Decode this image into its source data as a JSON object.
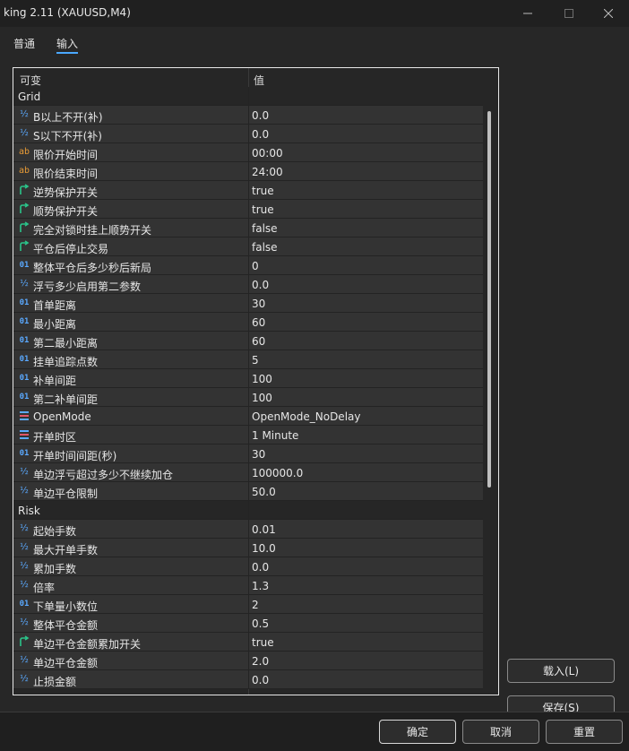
{
  "window": {
    "title": "king 2.11 (XAUUSD,M4)"
  },
  "tabs": [
    {
      "label": "普通",
      "active": false
    },
    {
      "label": "输入",
      "active": true
    }
  ],
  "grid": {
    "header": {
      "name": "可变",
      "value": "值"
    },
    "rows": [
      {
        "kind": "group",
        "name": "Grid"
      },
      {
        "kind": "param",
        "icon": "half-icon",
        "name": "B以上不开(补)",
        "value": "0.0"
      },
      {
        "kind": "param",
        "icon": "half-icon",
        "name": "S以下不开(补)",
        "value": "0.0"
      },
      {
        "kind": "param",
        "icon": "ab-icon",
        "name": "限价开始时间",
        "value": "00:00"
      },
      {
        "kind": "param",
        "icon": "ab-icon",
        "name": "限价结束时间",
        "value": "24:00"
      },
      {
        "kind": "param",
        "icon": "bool-arrow-icon",
        "name": "逆势保护开关",
        "value": "true"
      },
      {
        "kind": "param",
        "icon": "bool-arrow-icon",
        "name": "顺势保护开关",
        "value": "true"
      },
      {
        "kind": "param",
        "icon": "bool-arrow-icon",
        "name": "完全对锁时挂上顺势开关",
        "value": "false"
      },
      {
        "kind": "param",
        "icon": "bool-arrow-icon",
        "name": "平仓后停止交易",
        "value": "false"
      },
      {
        "kind": "param",
        "icon": "int-icon",
        "name": "整体平仓后多少秒后新局",
        "value": "0"
      },
      {
        "kind": "param",
        "icon": "half-icon",
        "name": "浮亏多少启用第二参数",
        "value": "0.0"
      },
      {
        "kind": "param",
        "icon": "int-icon",
        "name": "首单距离",
        "value": "30"
      },
      {
        "kind": "param",
        "icon": "int-icon",
        "name": "最小距离",
        "value": "60"
      },
      {
        "kind": "param",
        "icon": "int-icon",
        "name": "第二最小距离",
        "value": "60"
      },
      {
        "kind": "param",
        "icon": "int-icon",
        "name": "挂单追踪点数",
        "value": "5"
      },
      {
        "kind": "param",
        "icon": "int-icon",
        "name": "补单间距",
        "value": "100"
      },
      {
        "kind": "param",
        "icon": "int-icon",
        "name": "第二补单间距",
        "value": "100"
      },
      {
        "kind": "param",
        "icon": "enum-icon",
        "name": "OpenMode",
        "value": "OpenMode_NoDelay"
      },
      {
        "kind": "param",
        "icon": "enum-icon",
        "name": "开单时区",
        "value": "1 Minute"
      },
      {
        "kind": "param",
        "icon": "int-icon",
        "name": "开单时间间距(秒)",
        "value": "30"
      },
      {
        "kind": "param",
        "icon": "half-icon",
        "name": "单边浮亏超过多少不继续加仓",
        "value": "100000.0"
      },
      {
        "kind": "param",
        "icon": "half-icon",
        "name": "单边平仓限制",
        "value": "50.0"
      },
      {
        "kind": "group",
        "name": "Risk"
      },
      {
        "kind": "param",
        "icon": "half-icon",
        "name": "起始手数",
        "value": "0.01"
      },
      {
        "kind": "param",
        "icon": "half-icon",
        "name": "最大开单手数",
        "value": "10.0"
      },
      {
        "kind": "param",
        "icon": "half-icon",
        "name": "累加手数",
        "value": "0.0"
      },
      {
        "kind": "param",
        "icon": "half-icon",
        "name": "倍率",
        "value": "1.3"
      },
      {
        "kind": "param",
        "icon": "int-icon",
        "name": "下单量小数位",
        "value": "2"
      },
      {
        "kind": "param",
        "icon": "half-icon",
        "name": "整体平仓金额",
        "value": "0.5"
      },
      {
        "kind": "param",
        "icon": "bool-arrow-icon",
        "name": "单边平仓金额累加开关",
        "value": "true"
      },
      {
        "kind": "param",
        "icon": "half-icon",
        "name": "单边平仓金额",
        "value": "2.0"
      },
      {
        "kind": "param",
        "icon": "half-icon",
        "name": "止损金额",
        "value": "0.0"
      }
    ]
  },
  "side_buttons": {
    "load": "载入(L)",
    "save": "保存(S)"
  },
  "footer_buttons": {
    "ok": "确定",
    "cancel": "取消",
    "reset": "重置"
  },
  "colors": {
    "accent": "#4aa8ff",
    "bool_icon": "#2bc48a",
    "string_icon": "#e69a36",
    "number_icon": "#5aa9ff"
  }
}
